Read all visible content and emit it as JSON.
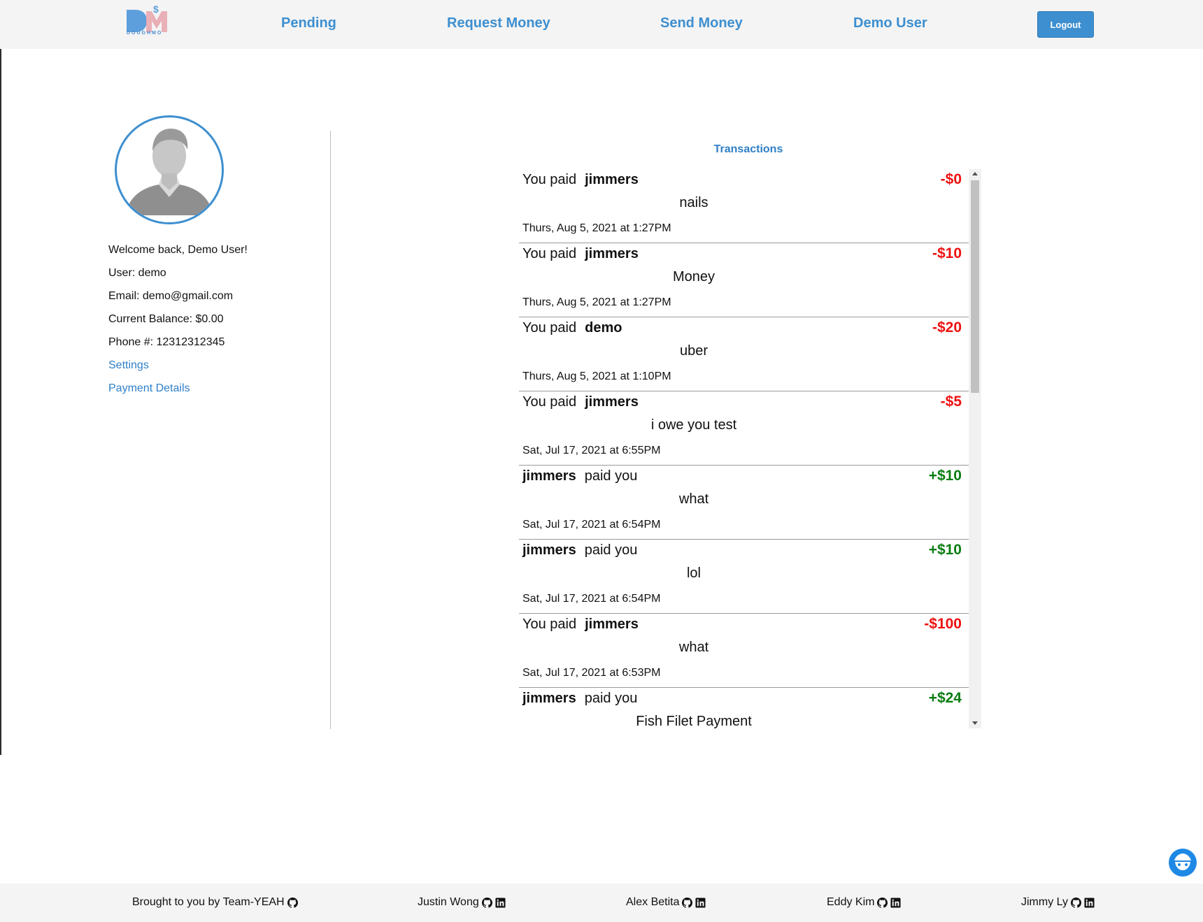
{
  "brand": {
    "logo_text": "DOUGHMO"
  },
  "nav": {
    "pending": "Pending",
    "request_money": "Request Money",
    "send_money": "Send Money",
    "user": "Demo User",
    "logout": "Logout"
  },
  "profile": {
    "welcome": "Welcome back, Demo User!",
    "user": "User: demo",
    "email": "Email: demo@gmail.com",
    "balance": "Current Balance: $0.00",
    "phone": "Phone #: 12312312345",
    "settings": "Settings",
    "payment_details": "Payment Details"
  },
  "transactions": {
    "title": "Transactions",
    "items": [
      {
        "prefix": "You paid",
        "name": "jimmers",
        "suffix": "",
        "amount": "-$0",
        "memo": "nails",
        "date": "Thurs, Aug 5, 2021 at 1:27PM"
      },
      {
        "prefix": "You paid",
        "name": "jimmers",
        "suffix": "",
        "amount": "-$10",
        "memo": "Money",
        "date": "Thurs, Aug 5, 2021 at 1:27PM"
      },
      {
        "prefix": "You paid",
        "name": "demo",
        "suffix": "",
        "amount": "-$20",
        "memo": "uber",
        "date": "Thurs, Aug 5, 2021 at 1:10PM"
      },
      {
        "prefix": "You paid",
        "name": "jimmers",
        "suffix": "",
        "amount": "-$5",
        "memo": "i owe you test",
        "date": "Sat, Jul 17, 2021 at 6:55PM"
      },
      {
        "prefix": "",
        "name": "jimmers",
        "suffix": "paid you",
        "amount": "+$10",
        "memo": "what",
        "date": "Sat, Jul 17, 2021 at 6:54PM"
      },
      {
        "prefix": "",
        "name": "jimmers",
        "suffix": "paid you",
        "amount": "+$10",
        "memo": "lol",
        "date": "Sat, Jul 17, 2021 at 6:54PM"
      },
      {
        "prefix": "You paid",
        "name": "jimmers",
        "suffix": "",
        "amount": "-$100",
        "memo": "what",
        "date": "Sat, Jul 17, 2021 at 6:53PM"
      },
      {
        "prefix": "",
        "name": "jimmers",
        "suffix": "paid you",
        "amount": "+$24",
        "memo": "Fish Filet Payment",
        "date": ""
      }
    ]
  },
  "footer": {
    "team": "Brought to you by Team-YEAH",
    "members": [
      "Justin Wong",
      "Alex Betita",
      "Eddy Kim",
      "Jimmy Ly"
    ]
  },
  "colors": {
    "accent": "#3d8fd0",
    "negative": "#ee1111",
    "positive": "#0a7d12"
  },
  "icons": [
    "github-icon",
    "linkedin-icon",
    "scroll-up-icon",
    "scroll-down-icon",
    "chat-widget-icon"
  ]
}
